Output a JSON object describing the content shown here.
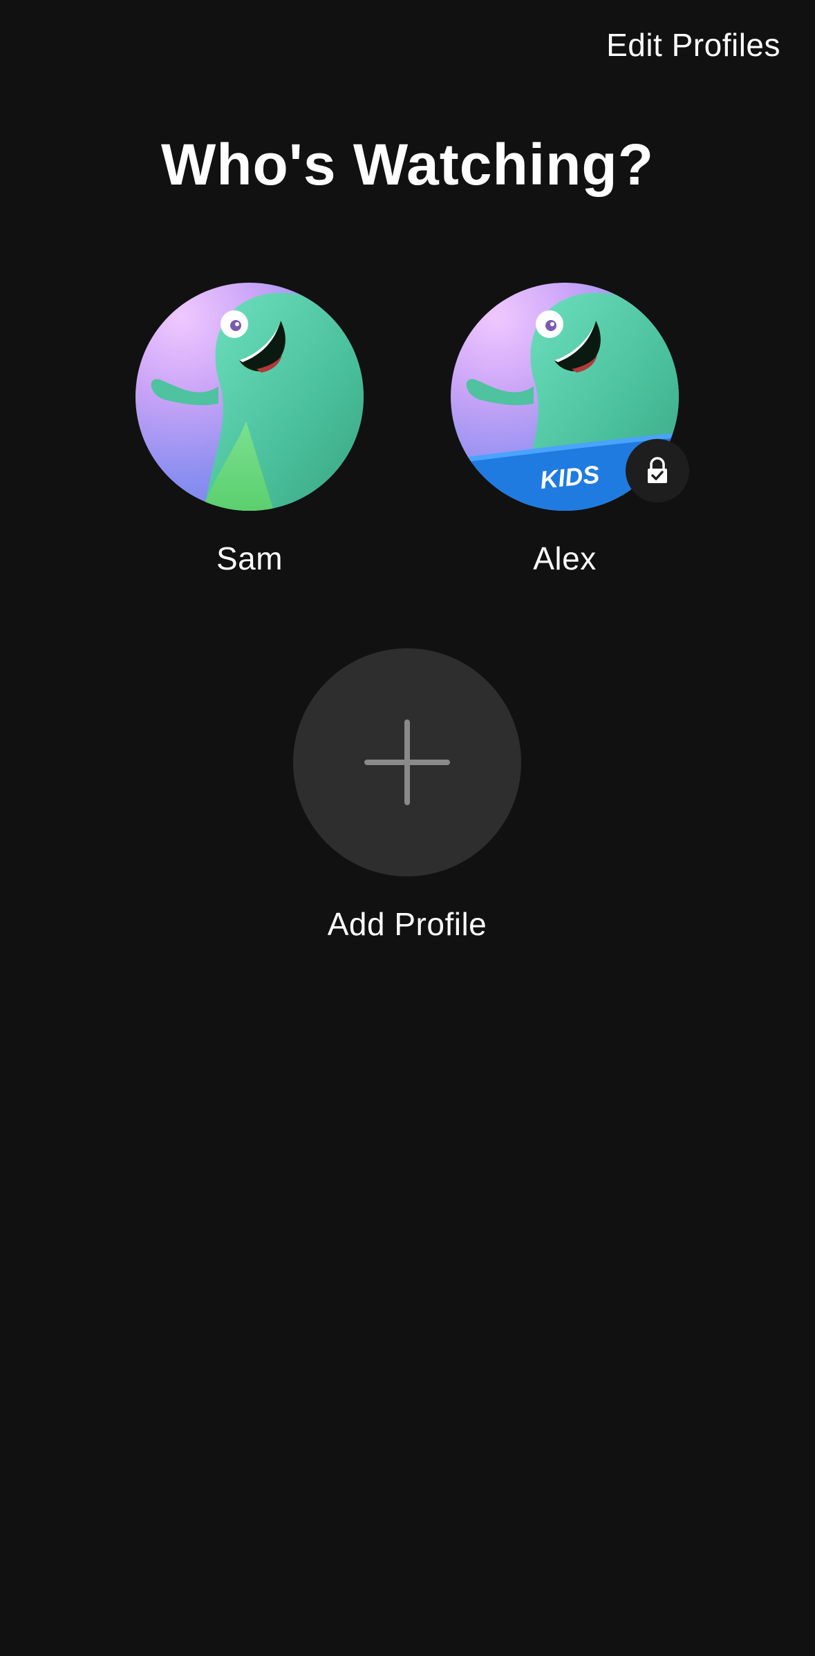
{
  "header": {
    "edit_label": "Edit Profiles"
  },
  "title": "Who's Watching?",
  "profiles": [
    {
      "name": "Sam",
      "avatar_icon": "green-monster-avatar",
      "kids": false,
      "locked": false
    },
    {
      "name": "Alex",
      "avatar_icon": "green-monster-avatar",
      "kids": true,
      "kids_badge": "KIDS",
      "locked": true
    }
  ],
  "add_profile": {
    "label": "Add Profile",
    "icon": "plus-icon"
  },
  "colors": {
    "background": "#111111",
    "add_circle": "#2e2e2e",
    "kids_banner": "#1f7be0",
    "text": "#ffffff"
  }
}
